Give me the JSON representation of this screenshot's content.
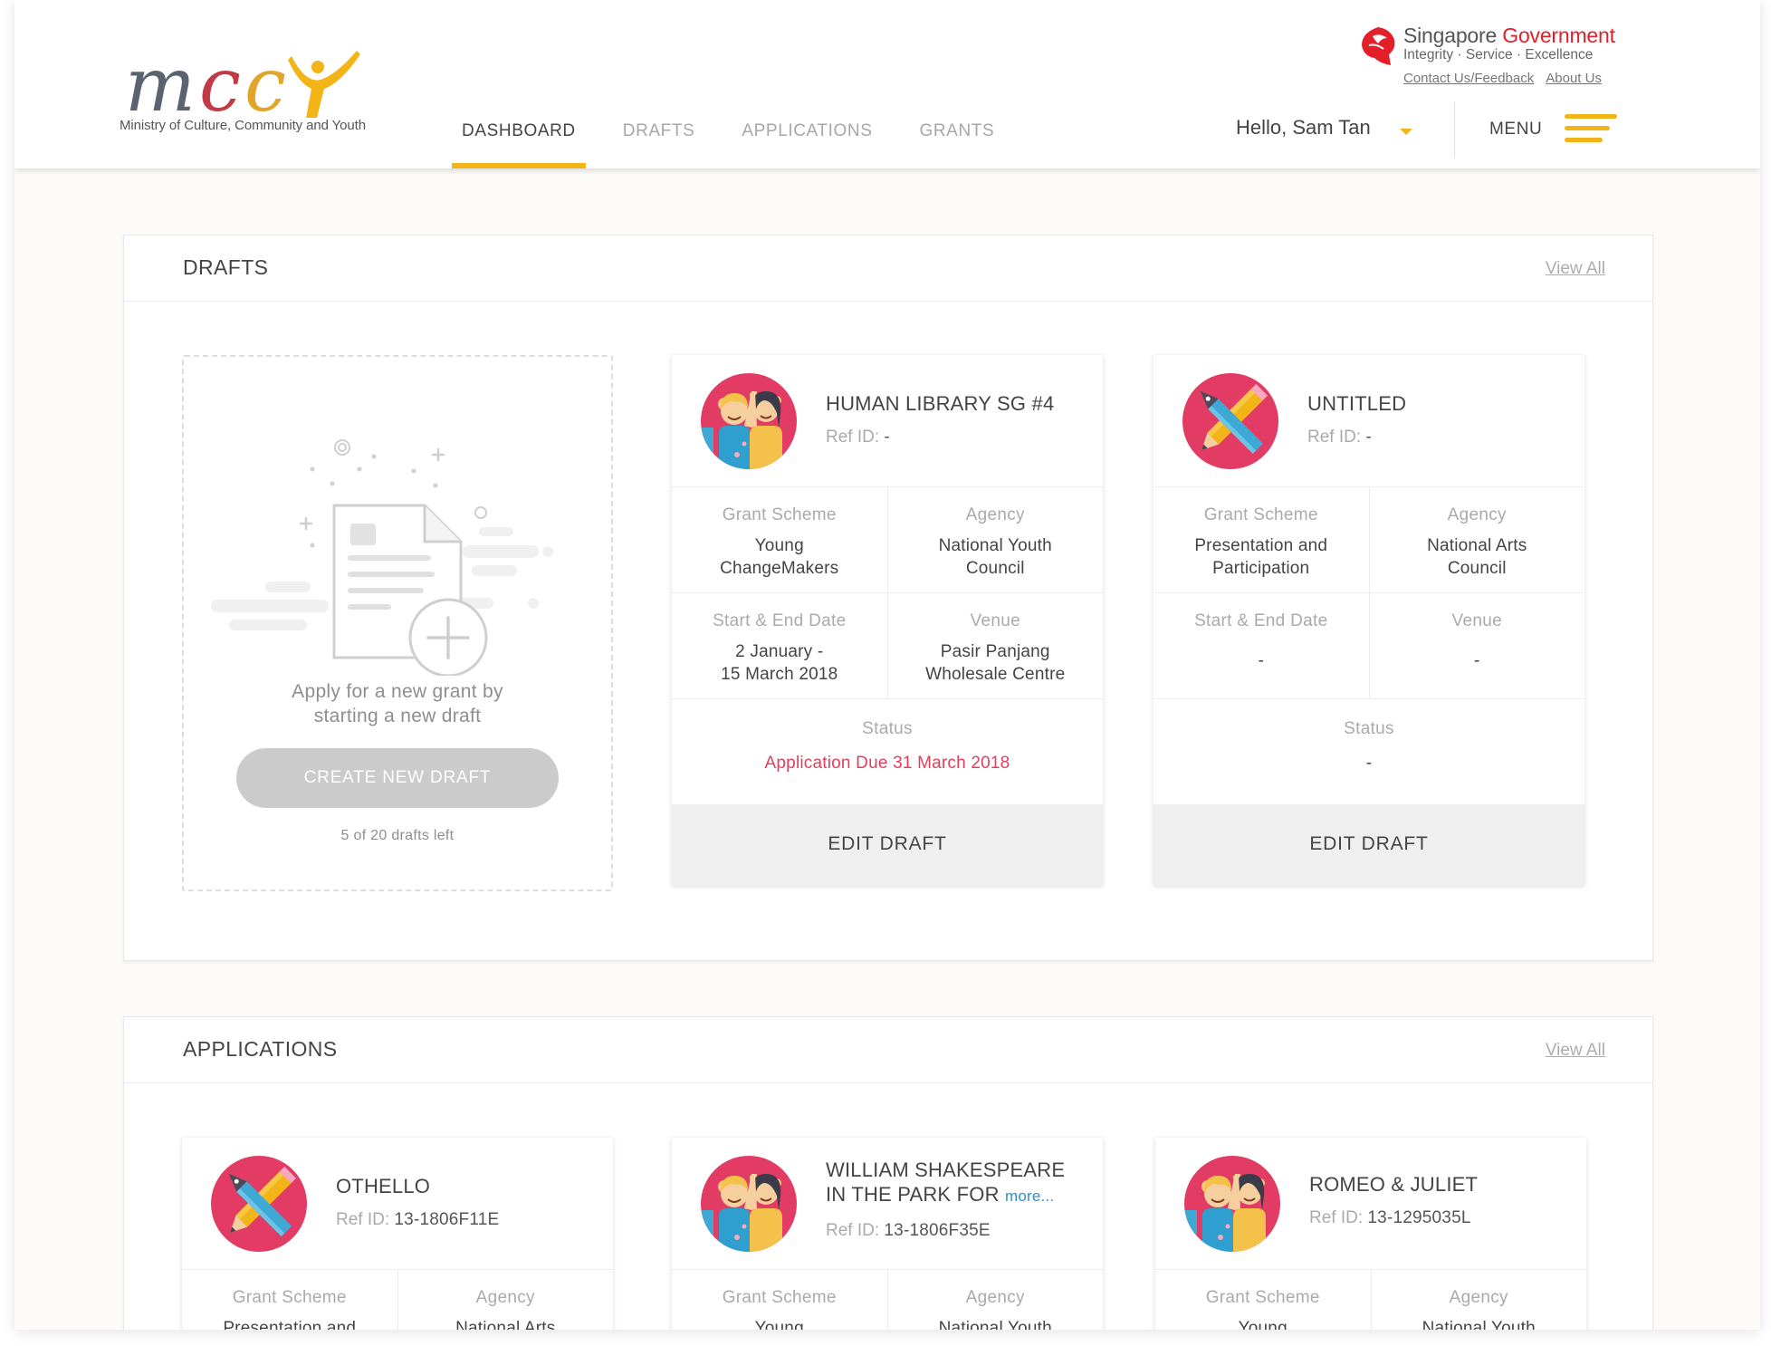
{
  "header": {
    "logo_sub": "Ministry of Culture, Community and Youth",
    "nav": [
      "DASHBOARD",
      "DRAFTS",
      "APPLICATIONS",
      "GRANTS"
    ],
    "gov_title_a": "Singapore ",
    "gov_title_b": "Government",
    "gov_motto": "Integrity · Service · Excellence",
    "gov_link_contact": "Contact Us/Feedback",
    "gov_link_about": "About Us",
    "greeting": "Hello, Sam Tan",
    "menu_label": "MENU"
  },
  "drafts": {
    "title": "DRAFTS",
    "view_all": "View All",
    "new_draft_text_1": "Apply for a new grant by",
    "new_draft_text_2": "starting a new draft",
    "create_button": "CREATE NEW DRAFT",
    "drafts_left": "5 of 20 drafts left",
    "cards": [
      {
        "title": "HUMAN LIBRARY SG #4",
        "ref_label": "Ref ID:",
        "ref_value": "-",
        "grant_scheme_label": "Grant Scheme",
        "grant_scheme_1": "Young",
        "grant_scheme_2": "ChangeMakers",
        "agency_label": "Agency",
        "agency_1": "National Youth",
        "agency_2": "Council",
        "date_label": "Start & End Date",
        "date_1": "2 January -",
        "date_2": "15 March 2018",
        "venue_label": "Venue",
        "venue_1": "Pasir Panjang",
        "venue_2": "Wholesale Centre",
        "status_label": "Status",
        "status_value": "Application Due 31 March 2018",
        "edit_button": "EDIT DRAFT",
        "icon": "people-high-five-icon"
      },
      {
        "title": "UNTITLED",
        "ref_label": "Ref ID:",
        "ref_value": "-",
        "grant_scheme_label": "Grant Scheme",
        "grant_scheme_1": "Presentation and",
        "grant_scheme_2": "Participation",
        "agency_label": "Agency",
        "agency_1": "National Arts",
        "agency_2": "Council",
        "date_label": "Start & End Date",
        "date_value": "-",
        "venue_label": "Venue",
        "venue_value": "-",
        "status_label": "Status",
        "status_value": "-",
        "edit_button": "EDIT DRAFT",
        "icon": "pen-pencil-icon"
      }
    ]
  },
  "applications": {
    "title": "APPLICATIONS",
    "view_all": "View All",
    "cards": [
      {
        "title": "OTHELLO",
        "ref_label": "Ref ID:",
        "ref_value": "13-1806F11E",
        "grant_scheme_label": "Grant Scheme",
        "grant_scheme_1": "Presentation and",
        "agency_label": "Agency",
        "agency_1": "National Arts",
        "icon": "pen-pencil-icon"
      },
      {
        "title_1": "WILLIAM SHAKESPEARE",
        "title_2": "IN THE PARK FOR",
        "more": "more...",
        "ref_label": "Ref ID:",
        "ref_value": "13-1806F35E",
        "grant_scheme_label": "Grant Scheme",
        "grant_scheme_1": "Young",
        "agency_label": "Agency",
        "agency_1": "National Youth",
        "icon": "people-high-five-icon"
      },
      {
        "title": "ROMEO & JULIET",
        "ref_label": "Ref ID:",
        "ref_value": "13-1295035L",
        "grant_scheme_label": "Grant Scheme",
        "grant_scheme_1": "Young",
        "agency_label": "Agency",
        "agency_1": "National Youth",
        "icon": "people-high-five-icon"
      }
    ]
  },
  "colors": {
    "accent": "#f2b417",
    "status_due": "#e53d5c",
    "link": "#2a8fd6",
    "gov_red": "#e3202a"
  }
}
